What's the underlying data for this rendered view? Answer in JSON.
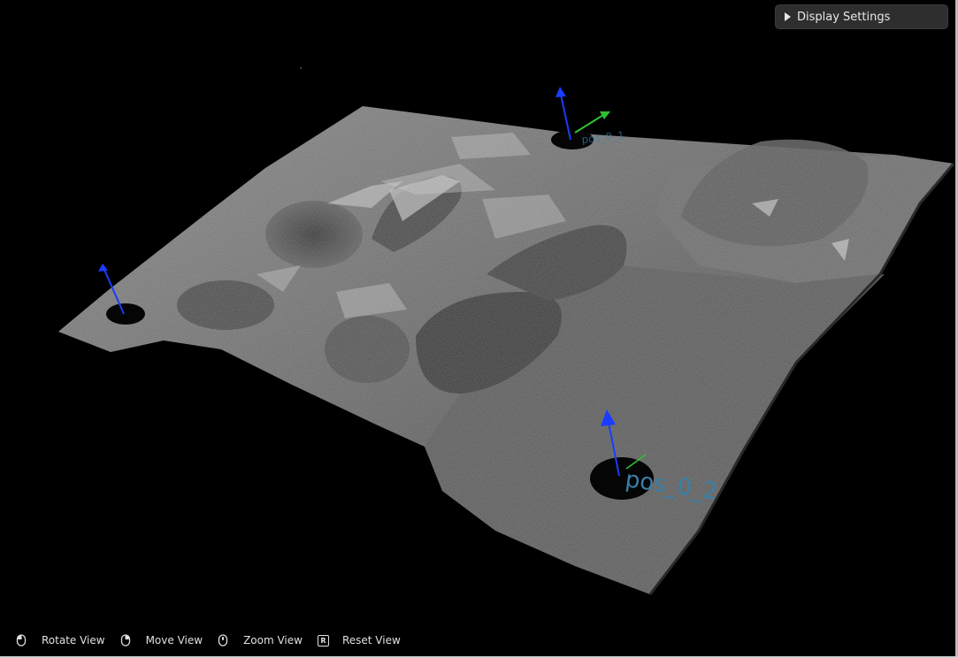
{
  "display_settings": {
    "label": "Display Settings"
  },
  "points": [
    {
      "label": "pos_0_0"
    },
    {
      "label": "pos_0_1"
    },
    {
      "label": "pos_0_2"
    }
  ],
  "controls": [
    {
      "label": "Rotate View",
      "icon": "mouse-left-icon"
    },
    {
      "label": "Move View",
      "icon": "mouse-right-icon"
    },
    {
      "label": "Zoom View",
      "icon": "mouse-wheel-icon"
    },
    {
      "label": "Reset View",
      "icon": "r-key-icon",
      "key": "R"
    }
  ],
  "colors": {
    "background": "#000000",
    "axis_z": "#1a3cff",
    "axis_y": "#2fc22f",
    "point_label": "#3a7fa8",
    "panel": "#2e2e2e"
  }
}
